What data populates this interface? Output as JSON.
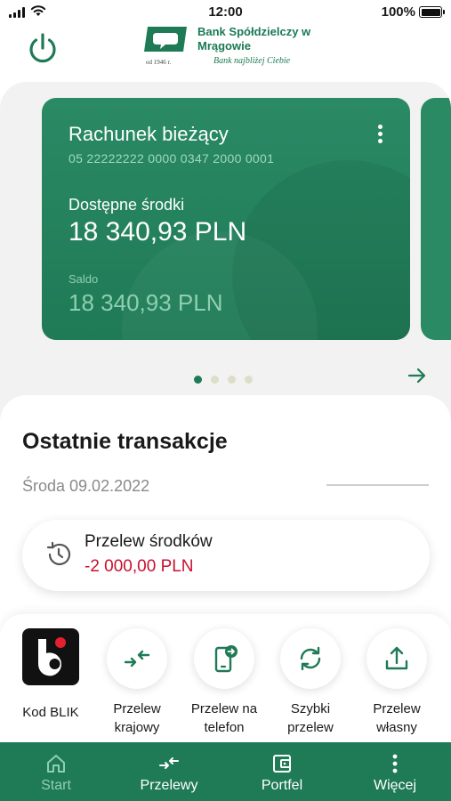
{
  "status_bar": {
    "time": "12:00",
    "battery": "100%"
  },
  "bank": {
    "name": "Bank Spółdzielczy w Mrągowie",
    "since": "od 1946 r.",
    "tagline": "Bank najbliżej Ciebie",
    "brand_color": "#1f7a56"
  },
  "account": {
    "title": "Rachunek bieżący",
    "number": "05 22222222 0000 0347 2000 0001",
    "available_label": "Dostępne środki",
    "available_value": "18 340,93 PLN",
    "saldo_label": "Saldo",
    "saldo_value": "18 340,93 PLN"
  },
  "carousel": {
    "page_count": 4,
    "active_index": 0
  },
  "transactions": {
    "title": "Ostatnie transakcje",
    "date": "Środa 09.02.2022",
    "items": [
      {
        "name": "Przelew środków",
        "amount": "-2 000,00 PLN",
        "icon": "history-icon",
        "amount_color": "#c8102e"
      }
    ]
  },
  "quick_actions": [
    {
      "label": "Kod BLIK",
      "icon": "blik-logo"
    },
    {
      "label": "Przelew krajowy",
      "icon": "transfer-arrows-icon"
    },
    {
      "label": "Przelew na telefon",
      "icon": "phone-transfer-icon"
    },
    {
      "label": "Szybki przelew",
      "icon": "refresh-icon"
    },
    {
      "label": "Przelew własny",
      "icon": "upload-icon"
    }
  ],
  "nav": [
    {
      "label": "Start",
      "icon": "home-icon",
      "active": true
    },
    {
      "label": "Przelewy",
      "icon": "transfer-arrows-icon"
    },
    {
      "label": "Portfel",
      "icon": "wallet-icon"
    },
    {
      "label": "Więcej",
      "icon": "more-vertical-icon"
    }
  ]
}
